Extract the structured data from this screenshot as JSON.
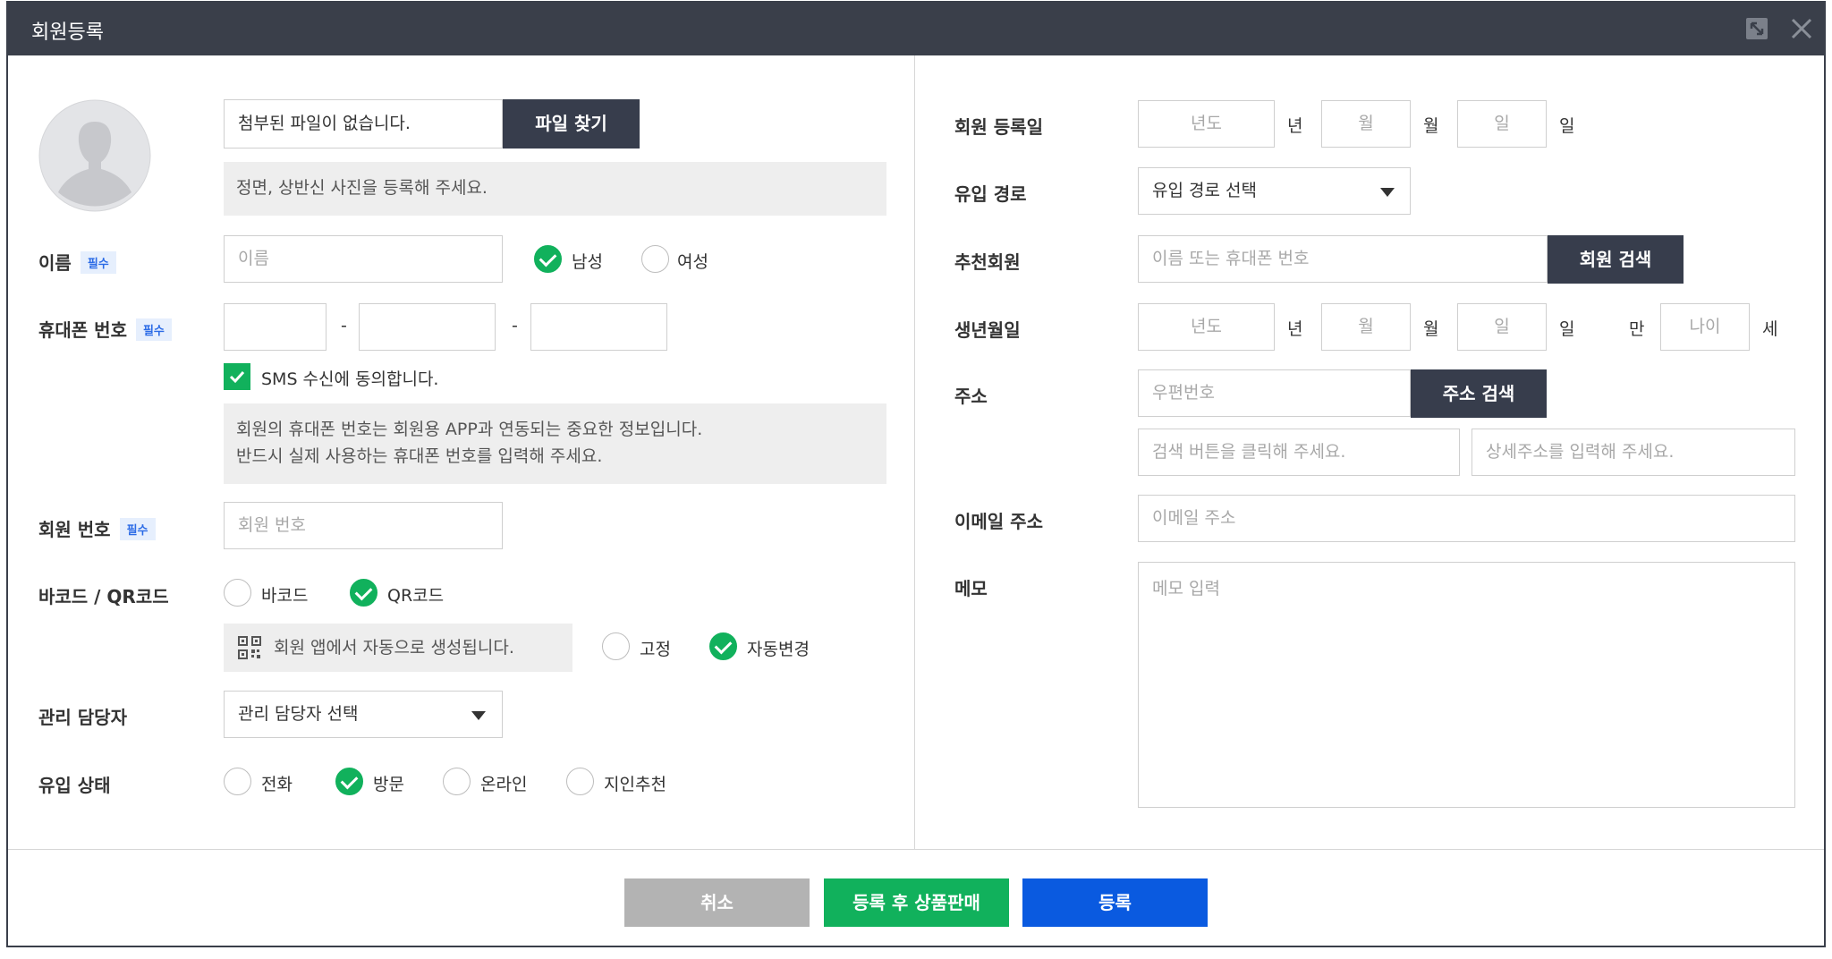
{
  "window": {
    "title": "회원등록",
    "expand_icon": "expand-icon",
    "close_icon": "close-icon"
  },
  "photo": {
    "file_status": "첨부된 파일이 없습니다.",
    "find_file_button": "파일 찾기",
    "hint": "정면, 상반신 사진을 등록해 주세요."
  },
  "name": {
    "label": "이름",
    "required": "필수",
    "placeholder": "이름",
    "gender_male": "남성",
    "gender_female": "여성",
    "selected_gender": "남성"
  },
  "phone": {
    "label": "휴대폰 번호",
    "required": "필수",
    "separator": "-",
    "sms_consent": "SMS 수신에 동의합니다.",
    "sms_checked": true,
    "notice_line1": "회원의 휴대폰 번호는 회원용 APP과 연동되는 중요한 정보입니다.",
    "notice_line2": "반드시 실제 사용하는 휴대폰 번호를 입력해 주세요."
  },
  "member_no": {
    "label": "회원 번호",
    "required": "필수",
    "placeholder": "회원 번호"
  },
  "code": {
    "label": "바코드 / QR코드",
    "barcode": "바코드",
    "qrcode": "QR코드",
    "selected": "QR코드",
    "info": "회원 앱에서 자동으로 생성됩니다.",
    "fixed": "고정",
    "auto": "자동변경",
    "selected_mode": "자동변경"
  },
  "manager": {
    "label": "관리 담당자",
    "select_value": "관리 담당자 선택"
  },
  "inflow_status": {
    "label": "유입 상태",
    "options": [
      "전화",
      "방문",
      "온라인",
      "지인추천"
    ],
    "selected": "방문"
  },
  "reg_date": {
    "label": "회원 등록일",
    "year_placeholder": "년도",
    "year_unit": "년",
    "month_placeholder": "월",
    "month_unit": "월",
    "day_placeholder": "일",
    "day_unit": "일"
  },
  "inflow_route": {
    "label": "유입 경로",
    "select_value": "유입 경로 선택"
  },
  "referrer": {
    "label": "추천회원",
    "placeholder": "이름 또는 휴대폰 번호",
    "search_button": "회원 검색"
  },
  "birth": {
    "label": "생년월일",
    "year_placeholder": "년도",
    "year_unit": "년",
    "month_placeholder": "월",
    "month_unit": "월",
    "day_placeholder": "일",
    "day_unit": "일",
    "age_prefix": "만",
    "age_placeholder": "나이",
    "age_unit": "세"
  },
  "address": {
    "label": "주소",
    "zip_placeholder": "우편번호",
    "search_button": "주소 검색",
    "addr_placeholder": "검색 버튼을 클릭해 주세요.",
    "detail_placeholder": "상세주소를 입력해 주세요."
  },
  "email": {
    "label": "이메일 주소",
    "placeholder": "이메일 주소"
  },
  "memo": {
    "label": "메모",
    "placeholder": "메모 입력"
  },
  "footer": {
    "cancel": "취소",
    "register_and_sell": "등록 후 상품판매",
    "register": "등록"
  },
  "colors": {
    "titlebar": "#3a3f4a",
    "dark_button": "#373d4c",
    "green": "#11b15c",
    "blue": "#0a5ae0",
    "gray_button": "#b3b3b3",
    "required_badge": "#2b6be6"
  }
}
